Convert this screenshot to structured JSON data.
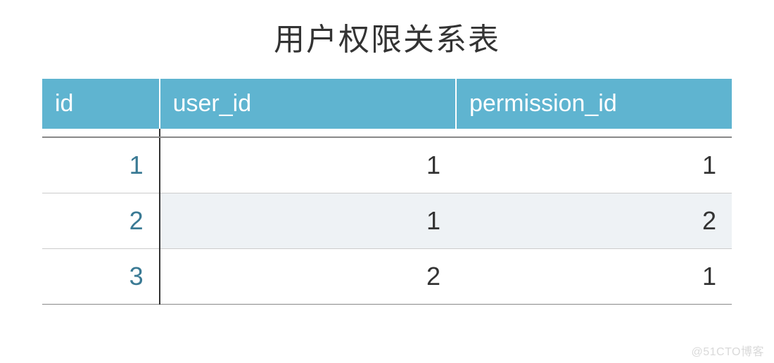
{
  "title": "用户权限关系表",
  "columns": [
    "id",
    "user_id",
    "permission_id"
  ],
  "rows": [
    {
      "id": "1",
      "user_id": "1",
      "permission_id": "1"
    },
    {
      "id": "2",
      "user_id": "1",
      "permission_id": "2"
    },
    {
      "id": "3",
      "user_id": "2",
      "permission_id": "1"
    }
  ],
  "watermark": "@51CTO博客",
  "chart_data": {
    "type": "table",
    "title": "用户权限关系表",
    "columns": [
      "id",
      "user_id",
      "permission_id"
    ],
    "data": [
      [
        1,
        1,
        1
      ],
      [
        2,
        1,
        2
      ],
      [
        3,
        2,
        1
      ]
    ]
  }
}
